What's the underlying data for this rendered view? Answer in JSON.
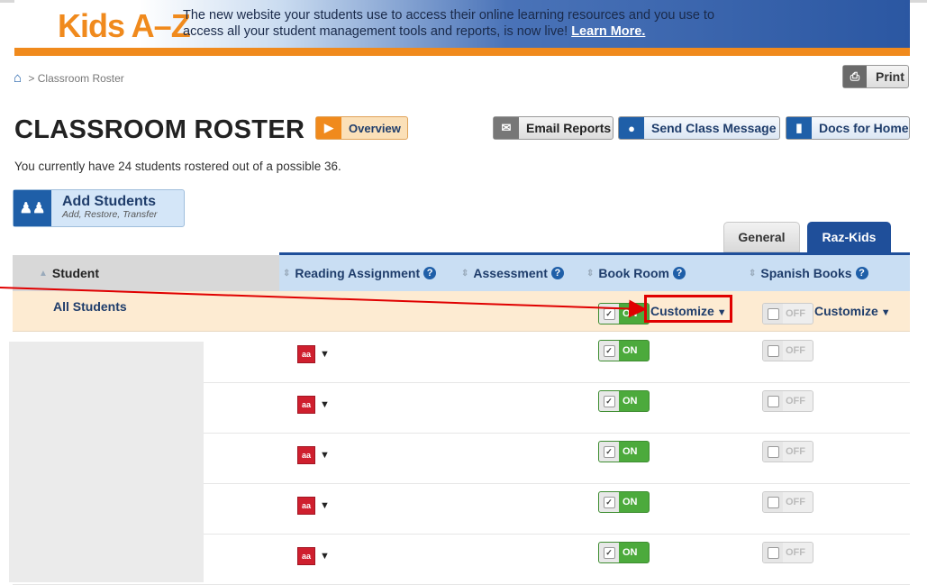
{
  "banner": {
    "logo": "Kids A–Z",
    "message": "The new website your students use to access their online learning resources and you use to access all your student management tools and reports, is now live!",
    "link": "Learn More."
  },
  "breadcrumb": {
    "home_icon": "home-icon",
    "separator": ">",
    "current": "Classroom Roster"
  },
  "toolbar": {
    "print": "Print",
    "overview": "Overview",
    "email_reports": "Email Reports",
    "send_class_message": "Send Class Message",
    "docs_for_home": "Docs for Home"
  },
  "page": {
    "title": "CLASSROOM ROSTER",
    "count_text": "You currently have 24 students rostered out of a possible 36."
  },
  "add_students": {
    "label": "Add Students",
    "sublabel": "Add, Restore, Transfer"
  },
  "tabs": [
    {
      "label": "General",
      "active": false
    },
    {
      "label": "Raz-Kids",
      "active": true
    }
  ],
  "table": {
    "headers": {
      "student": "Student",
      "reading_assignment": "Reading Assignment",
      "assessment": "Assessment",
      "book_room": "Book Room",
      "spanish_books": "Spanish Books"
    },
    "all_students": {
      "label": "All Students",
      "book_room_state": "ON",
      "book_room_customize": "Customize",
      "spanish_state": "OFF",
      "spanish_customize": "Customize"
    },
    "rows": [
      {
        "level": "aa",
        "book_room": "ON",
        "spanish": "OFF"
      },
      {
        "level": "aa",
        "book_room": "ON",
        "spanish": "OFF"
      },
      {
        "level": "aa",
        "book_room": "ON",
        "spanish": "OFF"
      },
      {
        "level": "aa",
        "book_room": "ON",
        "spanish": "OFF"
      },
      {
        "level": "aa",
        "book_room": "ON",
        "spanish": "OFF"
      }
    ]
  },
  "colors": {
    "brand_blue": "#1f4f9a",
    "orange": "#f08a1d",
    "on_green": "#4caa3c",
    "highlight_red": "#e00000"
  }
}
